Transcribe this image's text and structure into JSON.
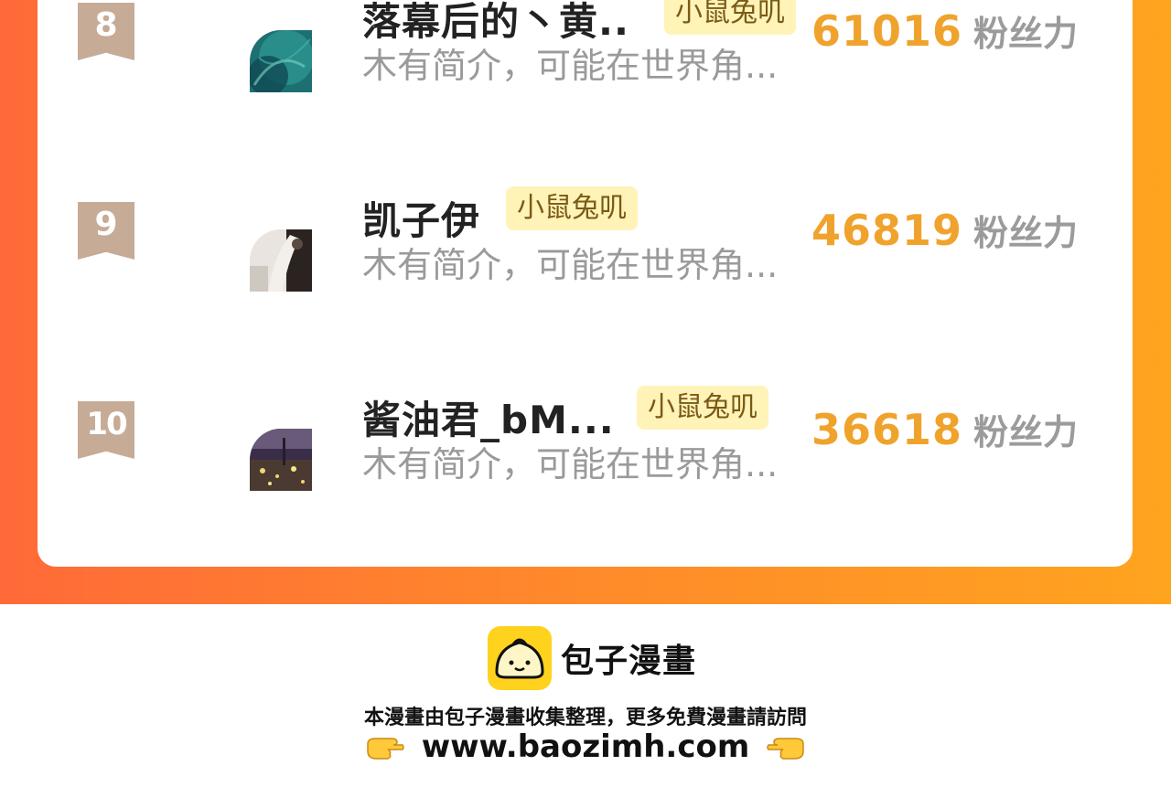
{
  "ranking": {
    "rows": [
      {
        "rank": "8",
        "name": "落幕后的丶黄..",
        "tag": "小鼠兔叽",
        "intro": "木有简介，可能在世界角...",
        "fans_value": "61016",
        "fans_unit": "粉丝力"
      },
      {
        "rank": "9",
        "name": "凯子伊",
        "tag": "小鼠兔叽",
        "intro": "木有简介，可能在世界角...",
        "fans_value": "46819",
        "fans_unit": "粉丝力"
      },
      {
        "rank": "10",
        "name": "酱油君_bM...",
        "tag": "小鼠兔叽",
        "intro": "木有简介，可能在世界角...",
        "fans_value": "36618",
        "fans_unit": "粉丝力"
      }
    ]
  },
  "footer": {
    "brand_name": "包子漫畫",
    "notice": "本漫畫由包子漫畫收集整理，更多免費漫畫請訪問",
    "url": "www.baozimh.com"
  },
  "colors": {
    "frame_left": "#ff6a38",
    "frame_right": "#ffa41f",
    "fans_number": "#f0a32c",
    "tag_bg": "#fff3b8",
    "rank_badge": "#c6ab97",
    "logo_yellow": "#ffd21e"
  },
  "icons": {
    "rank_badge": "ribbon-badge-icon",
    "brand_logo": "bun-logo-icon",
    "hand_left": "pointing-right-hand-icon",
    "hand_right": "pointing-left-hand-icon"
  }
}
